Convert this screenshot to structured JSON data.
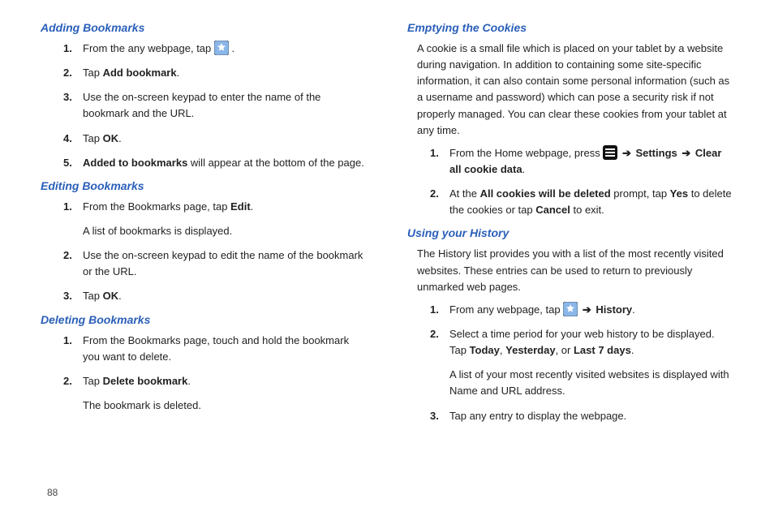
{
  "pageNumber": "88",
  "left": {
    "sec1": {
      "heading": "Adding Bookmarks",
      "step1_a": "From the any webpage, tap ",
      "step1_b": ".",
      "step2_a": "Tap ",
      "step2_b": "Add bookmark",
      "step2_c": ".",
      "step3": "Use the on-screen keypad to enter the name of the bookmark and the URL.",
      "step4_a": "Tap ",
      "step4_b": "OK",
      "step4_c": ".",
      "step5_a": "Added to bookmarks",
      "step5_b": " will appear at the bottom of the page."
    },
    "sec2": {
      "heading": "Editing Bookmarks",
      "step1_a": "From the Bookmarks page, tap ",
      "step1_b": "Edit",
      "step1_c": ".",
      "step1_sub": "A list of bookmarks is displayed.",
      "step2": "Use the on-screen keypad to edit the name of the bookmark or the URL.",
      "step3_a": "Tap ",
      "step3_b": "OK",
      "step3_c": "."
    },
    "sec3": {
      "heading": "Deleting Bookmarks",
      "step1": "From the Bookmarks page, touch and hold the bookmark you want to delete.",
      "step2_a": "Tap ",
      "step2_b": "Delete bookmark",
      "step2_c": ".",
      "step2_sub": "The bookmark is deleted."
    }
  },
  "right": {
    "sec1": {
      "heading": "Emptying the Cookies",
      "para": "A cookie is a small file which is placed on your tablet by a website during navigation. In addition to containing some site-specific information, it can also contain some personal information (such as a username and password) which can pose a security risk if not properly managed. You can clear these cookies from your tablet at any time.",
      "step1_a": "From the Home webpage, press ",
      "step1_b": " ➔ ",
      "step1_c": "Settings",
      "step1_d": " ➔ ",
      "step1_e": "Clear all cookie data",
      "step1_f": ".",
      "step2_a": "At the ",
      "step2_b": "All cookies will be deleted",
      "step2_c": " prompt, tap ",
      "step2_d": "Yes",
      "step2_e": " to delete the cookies or tap ",
      "step2_f": "Cancel",
      "step2_g": " to exit."
    },
    "sec2": {
      "heading": "Using your History",
      "para": "The History list provides you with a list of the most recently visited websites. These entries can be used to return to previously unmarked web pages.",
      "step1_a": "From any webpage, tap ",
      "step1_b": " ➔ ",
      "step1_c": "History",
      "step1_d": ".",
      "step2_a": "Select a time period for your web history to be displayed. Tap ",
      "step2_b": "Today",
      "step2_c": ", ",
      "step2_d": "Yesterday",
      "step2_e": ", or ",
      "step2_f": "Last 7 days",
      "step2_g": ".",
      "step2_sub": "A list of your most recently visited websites is displayed with Name and URL address.",
      "step3": "Tap any entry to display the webpage."
    }
  }
}
